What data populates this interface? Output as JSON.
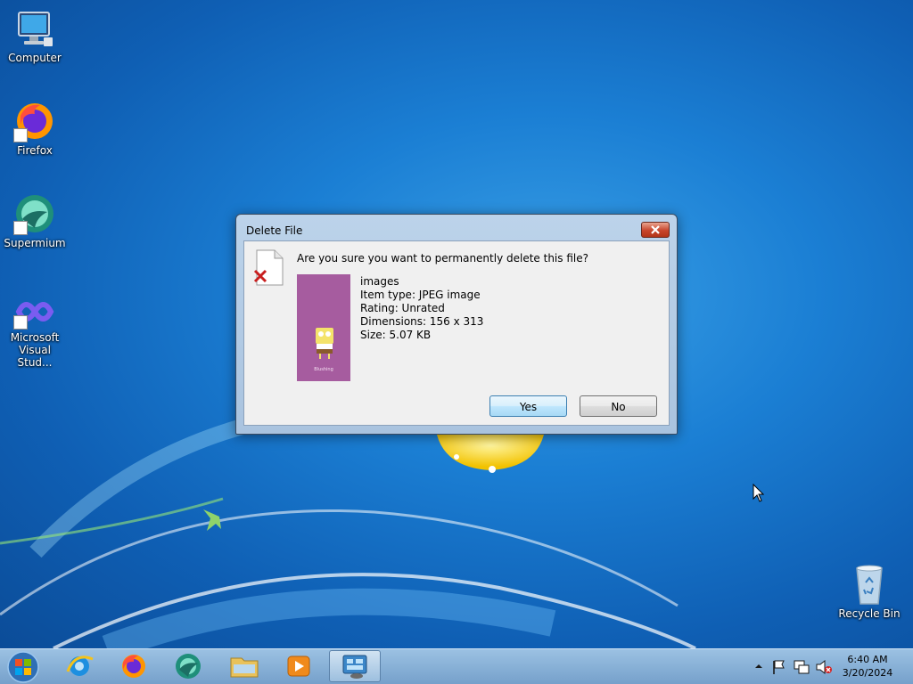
{
  "desktop": {
    "icons": [
      {
        "label": "Computer"
      },
      {
        "label": "Firefox"
      },
      {
        "label": "Supermium"
      },
      {
        "label": "Microsoft Visual Stud..."
      },
      {
        "label": "Recycle Bin"
      }
    ]
  },
  "dialog": {
    "title": "Delete File",
    "question": "Are you sure you want to permanently delete this file?",
    "file": {
      "name": "images",
      "item_type": "Item type: JPEG image",
      "rating": "Rating: Unrated",
      "dimensions": "Dimensions: 156 x 313",
      "size": "Size: 5.07 KB",
      "thumbnail_caption": "Blushing"
    },
    "yes_label": "Yes",
    "no_label": "No",
    "close_icon": "close-icon"
  },
  "taskbar": {
    "pinned": [
      {
        "name": "Internet Explorer",
        "icon": "ie-icon"
      },
      {
        "name": "Firefox",
        "icon": "firefox-icon"
      },
      {
        "name": "Supermium",
        "icon": "supermium-icon"
      },
      {
        "name": "Windows Explorer",
        "icon": "folder-icon"
      },
      {
        "name": "Windows Media Player",
        "icon": "media-player-icon"
      },
      {
        "name": "Control Panel",
        "icon": "control-panel-icon"
      }
    ],
    "clock": {
      "time": "6:40 AM",
      "date": "3/20/2024"
    }
  },
  "colors": {
    "wallpaper": "#1b7fd4",
    "dialog_frame": "#bcd3ea",
    "close_button": "#c8452c",
    "thumbnail_bg": "#a65c9f"
  }
}
